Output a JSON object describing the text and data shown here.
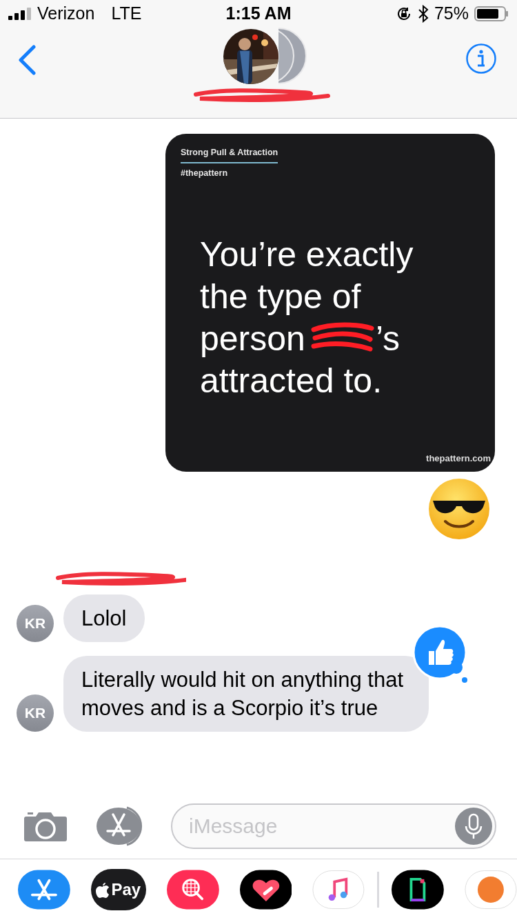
{
  "status_bar": {
    "carrier": "Verizon",
    "network": "LTE",
    "time": "1:15 AM",
    "battery": "75%"
  },
  "messages": [
    {
      "kind": "image_card",
      "from_me": true,
      "topic": "Strong Pull & Attraction",
      "hashtag": "#thepattern",
      "quote_lines": [
        [
          "You’re exactly"
        ],
        [
          "the type of"
        ],
        [
          "person",
          "’s"
        ],
        [
          "attracted to."
        ]
      ],
      "source": "thepattern.com"
    },
    {
      "kind": "emoji",
      "from_me": true
    },
    {
      "kind": "text",
      "from_me": false,
      "sender_redacted": true,
      "avatar": "KR",
      "text": "Lolol",
      "liked": false
    },
    {
      "kind": "text",
      "from_me": false,
      "sender_redacted": false,
      "avatar": "KR",
      "text": "Literally would hit on anything that moves and is a Scorpio it’s true",
      "liked": true
    }
  ],
  "composer": {
    "placeholder": "iMessage"
  },
  "app_strip": [
    {
      "kind": "app_store"
    },
    {
      "kind": "apple_pay",
      "label": "Pay"
    },
    {
      "kind": "image_search"
    },
    {
      "kind": "digital_touch"
    },
    {
      "kind": "music"
    },
    {
      "kind": "divider"
    },
    {
      "kind": "gif"
    },
    {
      "kind": "orange"
    }
  ]
}
